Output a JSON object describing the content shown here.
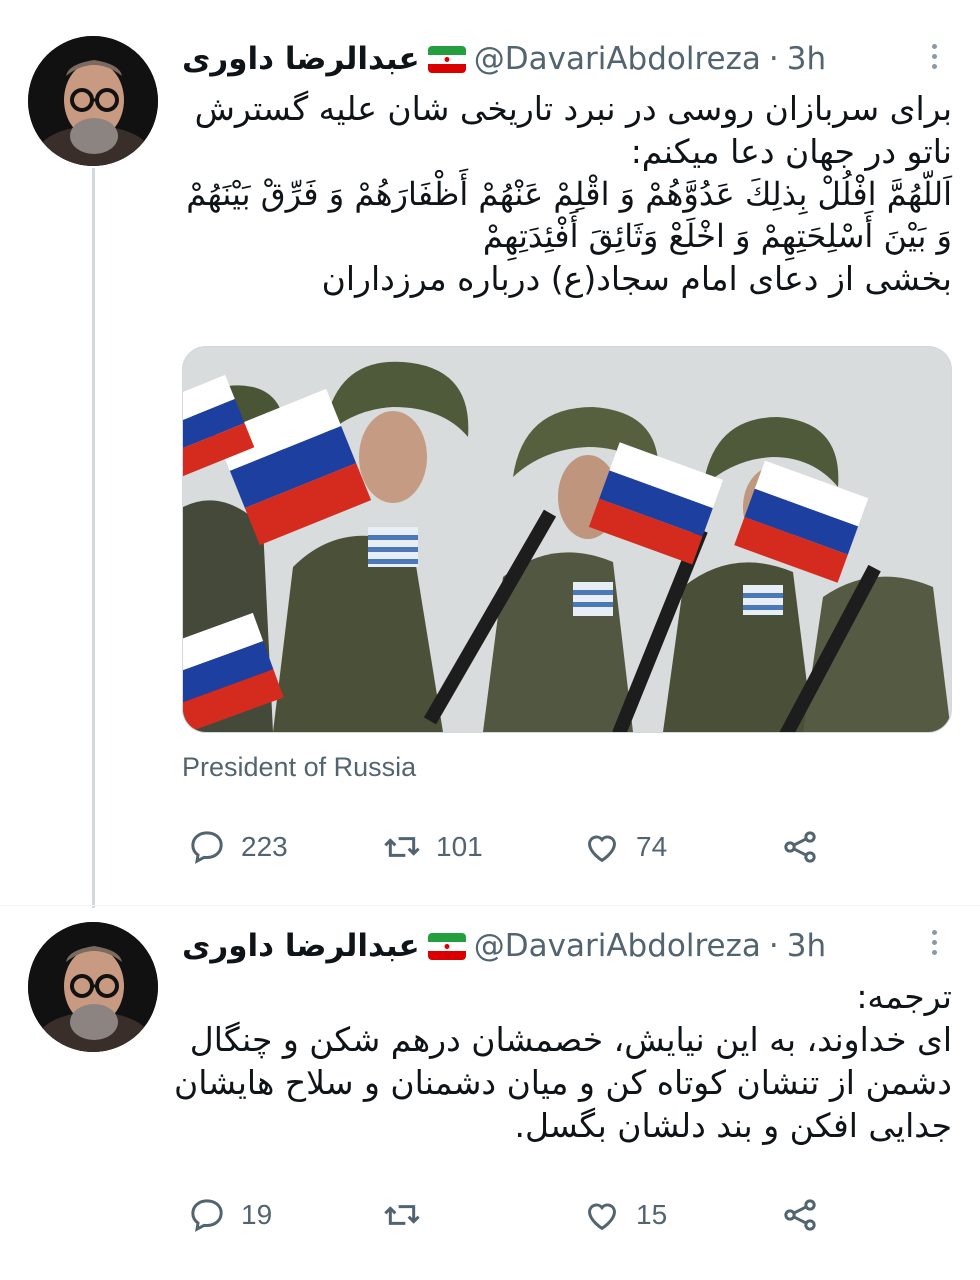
{
  "tweets": [
    {
      "display_name": "عبدالرضا داوری",
      "handle": "@DavariAbdolreza",
      "dot": "·",
      "time": "3h",
      "lines": [
        "برای سربازان روسی در نبرد تاریخی شان علیه گسترش",
        "ناتو در جهان دعا میکنم:",
        "اَللّهُمَّ افْلُلْ بِذلِكَ عَدُوَّهُمْ وَ اقْلِمْ عَنْهُمْ أَظْفَارَهُمْ وَ فَرِّقْ بَيْنَهُمْ",
        "وَ بَيْنَ أَسْلِحَتِهِمْ وَ اخْلَعْ وَثَائِقَ أَفْئِدَتِهِمْ",
        "بخشی از دعای امام سجاد(ع) درباره مرزداران"
      ],
      "media_caption": "President of Russia",
      "replies": "223",
      "retweets": "101",
      "likes": "74"
    },
    {
      "display_name": "عبدالرضا داوری",
      "handle": "@DavariAbdolreza",
      "dot": "·",
      "time": "3h",
      "lines": [
        "ترجمه:",
        "ای خداوند، به این نیایش، خصمشان درهم شکن و چنگال",
        "دشمن از تنشان کوتاه کن و میان دشمنان و سلاح هایشان",
        "جدایی افکن و بند دلشان بگسل."
      ],
      "replies": "19",
      "retweets": "",
      "likes": "15"
    }
  ],
  "colors": {
    "text_primary": "#0f1419",
    "text_secondary": "#536471",
    "thread_line": "#cfd9de"
  },
  "icons": [
    "reply-icon",
    "retweet-icon",
    "like-icon",
    "share-icon",
    "more-icon",
    "iran-flag-icon"
  ]
}
